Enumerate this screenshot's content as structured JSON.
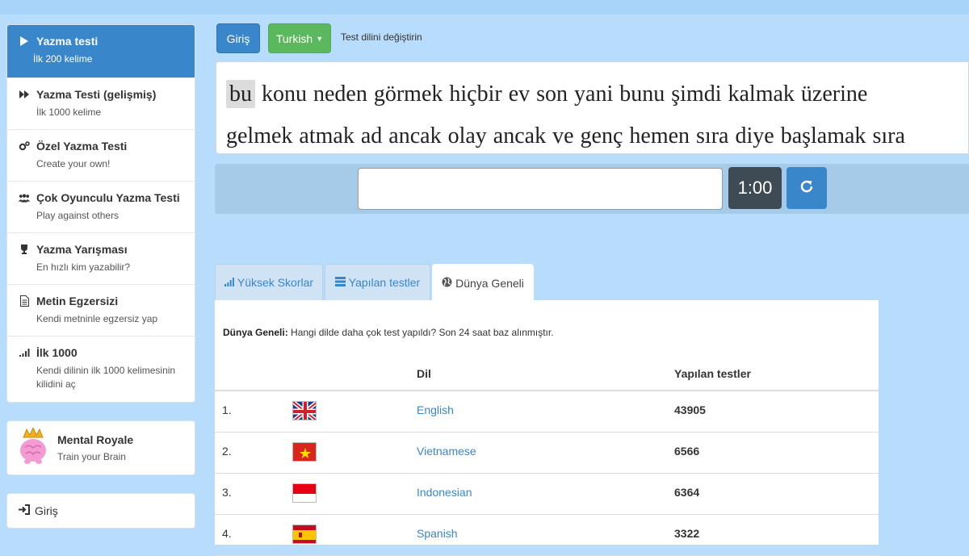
{
  "sidebar": {
    "items": [
      {
        "title": "Yazma testi",
        "sub": "İlk 200 kelime",
        "icon": "play-icon",
        "active": true
      },
      {
        "title": "Yazma Testi (gelişmiş)",
        "sub": "İlk 1000 kelime",
        "icon": "fast-forward-icon"
      },
      {
        "title": "Özel Yazma Testi",
        "sub": "Create your own!",
        "icon": "gears-icon"
      },
      {
        "title": "Çok Oyunculu Yazma Testi",
        "sub": "Play against others",
        "icon": "users-icon"
      },
      {
        "title": "Yazma Yarışması",
        "sub": "En hızlı kim yazabilir?",
        "icon": "trophy-icon"
      },
      {
        "title": "Metin Egzersizi",
        "sub": "Kendi metninle egzersiz yap",
        "icon": "document-icon"
      },
      {
        "title": "İlk 1000",
        "sub": "Kendi dilinin ilk 1000 kelimesinin kilidini aç",
        "icon": "signal-icon"
      }
    ],
    "promo": {
      "title": "Mental Royale",
      "sub": "Train your Brain",
      "icon": "brain-crown-icon"
    },
    "login": {
      "label": "Giriş",
      "icon": "login-icon"
    }
  },
  "toolbar": {
    "login_label": "Giriş",
    "language_label": "Turkish",
    "change_language_text": "Test dilini değiştirin"
  },
  "words": {
    "line1": [
      "bu",
      "konu",
      "neden",
      "görmek",
      "hiçbir",
      "ev",
      "son",
      "yani",
      "bunu",
      "şimdi",
      "kalmak",
      "üzerine"
    ],
    "line2": [
      "gelmek",
      "atmak",
      "ad",
      "ancak",
      "olay",
      "ancak",
      "ve",
      "genç",
      "hemen",
      "sıra",
      "diye",
      "başlamak",
      "sıra"
    ],
    "current_index": 0
  },
  "input": {
    "value": "",
    "timer": "1:00",
    "reload_icon": "refresh-icon"
  },
  "tabs": [
    {
      "label": "Yüksek Skorlar",
      "icon": "bar-chart-icon"
    },
    {
      "label": "Yapılan testler",
      "icon": "server-icon"
    },
    {
      "label": "Dünya Geneli",
      "icon": "globe-icon",
      "active": true
    }
  ],
  "panel": {
    "desc_bold": "Dünya Geneli:",
    "desc_text": " Hangi dilde daha çok test yapıldı? Son 24 saat baz alınmıştır.",
    "col_lang": "Dil",
    "col_tests": "Yapılan testler",
    "rows": [
      {
        "rank": "1.",
        "flag": "uk-flag",
        "language": "English",
        "tests": "43905"
      },
      {
        "rank": "2.",
        "flag": "vietnam-flag",
        "language": "Vietnamese",
        "tests": "6566"
      },
      {
        "rank": "3.",
        "flag": "indonesia-flag",
        "language": "Indonesian",
        "tests": "6364"
      },
      {
        "rank": "4.",
        "flag": "spain-flag",
        "language": "Spanish",
        "tests": "3322"
      }
    ]
  },
  "colors": {
    "primary": "#3a86cb",
    "success": "#5cb85c",
    "timer": "#3e4b55",
    "background": "#b8dcfb"
  }
}
